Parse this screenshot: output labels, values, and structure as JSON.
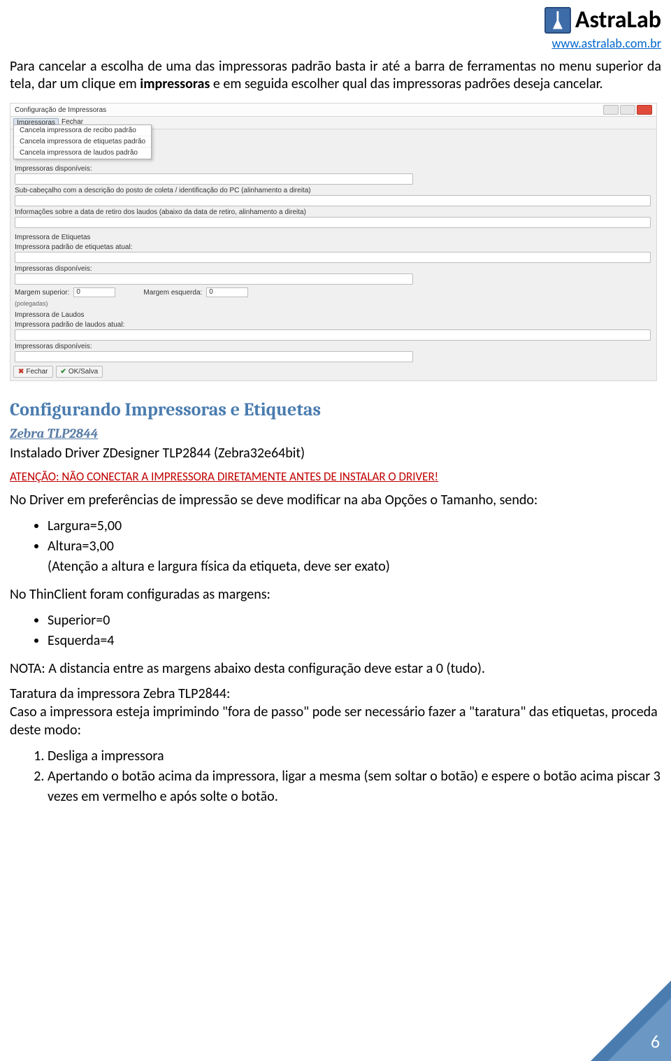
{
  "header": {
    "logo_text": "AstraLab",
    "site_url": "www.astralab.com.br"
  },
  "intro": "Para cancelar a escolha de uma das impressoras padrão basta ir até a barra de ferramentas no menu superior da tela, dar um clique em impressoras e em seguida escolher qual das impressoras padrões deseja cancelar.",
  "screenshot": {
    "window_title": "Configuração de Impressoras",
    "menu": {
      "impressoras": "Impressoras",
      "fechar": "Fechar"
    },
    "dropdown": [
      "Cancela impressora de recibo padrão",
      "Cancela impressora de etiquetas padrão",
      "Cancela impressora de laudos padrão"
    ],
    "labels": {
      "disp1": "Impressoras disponíveis:",
      "subcab": "Sub-cabeçalho com a descrição do posto de coleta / identificação do PC (alinhamento a direita)",
      "info_retiro": "Informações sobre a data de retiro dos laudos (abaixo da data de retiro, alinhamento a direita)",
      "etq_title": "Impressora de Etiquetas",
      "etq_atual": "Impressora padrão de etiquetas atual:",
      "disp2": "Impressoras disponíveis:",
      "m_sup": "Margem superior:",
      "m_sup_sub": "(polegadas)",
      "m_sup_val": "0",
      "m_esq": "Margem esquerda:",
      "m_esq_val": "0",
      "laudos_title": "Impressora de Laudos",
      "laudos_atual": "Impressora padrão de laudos atual:",
      "disp3": "Impressoras disponíveis:"
    },
    "buttons": {
      "fechar": "Fechar",
      "ok": "OK/Salva"
    }
  },
  "section_title": "Configurando Impressoras e Etiquetas",
  "sub_title": "Zebra TLP2844",
  "driver_line": "Instalado Driver ZDesigner TLP2844 (Zebra32e64bit)",
  "warning": "ATENÇÃO: NÃO CONECTAR A IMPRESSORA DIRETAMENTE ANTES DE INSTALAR O DRIVER!",
  "p_driver_pref": "No Driver em preferências de impressão se deve modificar na aba Opções o Tamanho, sendo:",
  "bullets1": {
    "b1": "Largura=5,00",
    "b2": "Altura=3,00",
    "b3": "(Atenção a altura e largura física da etiqueta, deve ser exato)"
  },
  "p_thin": "No ThinClient foram configuradas as margens:",
  "bullets2": {
    "b1": "Superior=0",
    "b2": "Esquerda=4"
  },
  "nota": "NOTA: A distancia entre as margens abaixo desta configuração deve estar a 0 (tudo).",
  "taratura_title": "Taratura da impressora Zebra TLP2844:",
  "taratura_body": "Caso a impressora esteja imprimindo \"fora de passo\" pode ser necessário fazer a \"taratura\" das etiquetas, proceda deste modo:",
  "steps": {
    "s1": "Desliga a impressora",
    "s2": "Apertando o botão acima da impressora, ligar a mesma (sem soltar o botão) e espere o botão acima piscar 3 vezes em vermelho e após solte o botão."
  },
  "page_number": "6"
}
